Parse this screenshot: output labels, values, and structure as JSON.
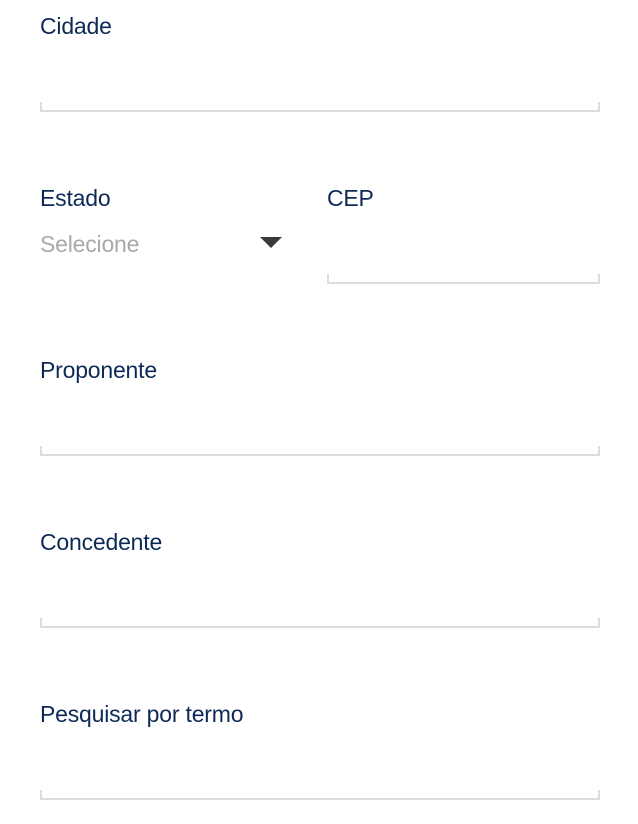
{
  "form": {
    "cidade": {
      "label": "Cidade",
      "value": ""
    },
    "estado": {
      "label": "Estado",
      "selected": "Selecione"
    },
    "cep": {
      "label": "CEP",
      "value": ""
    },
    "proponente": {
      "label": "Proponente",
      "value": ""
    },
    "concedente": {
      "label": "Concedente",
      "value": ""
    },
    "pesquisar": {
      "label": "Pesquisar por termo",
      "value": ""
    }
  },
  "icons": {
    "estado_dropdown": "chevron-down-icon"
  },
  "colors": {
    "label": "#0d2a57",
    "placeholder": "#a9a9a9",
    "underline": "#dcdcdc",
    "dropdown_arrow": "#3a3a3a",
    "background": "#ffffff"
  }
}
